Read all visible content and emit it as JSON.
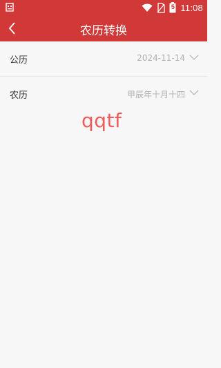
{
  "status_bar": {
    "time": "11:08",
    "battery": "5",
    "icons": [
      "notification-icon",
      "wifi-icon",
      "no-sim-icon",
      "battery-icon"
    ]
  },
  "app_bar": {
    "title": "农历转换",
    "back_icon": "chevron-left-icon"
  },
  "rows": [
    {
      "label": "公历",
      "value": "2024-11-14",
      "icon": "chevron-down-icon"
    },
    {
      "label": "农历",
      "value": "甲辰年十月十四",
      "icon": "chevron-down-icon"
    }
  ],
  "overlay_text": "qqtf",
  "colors": {
    "accent": "#d13838",
    "background": "#f7f7f7",
    "muted_text": "#b0b0b0",
    "overlay": "#f05b5b"
  }
}
